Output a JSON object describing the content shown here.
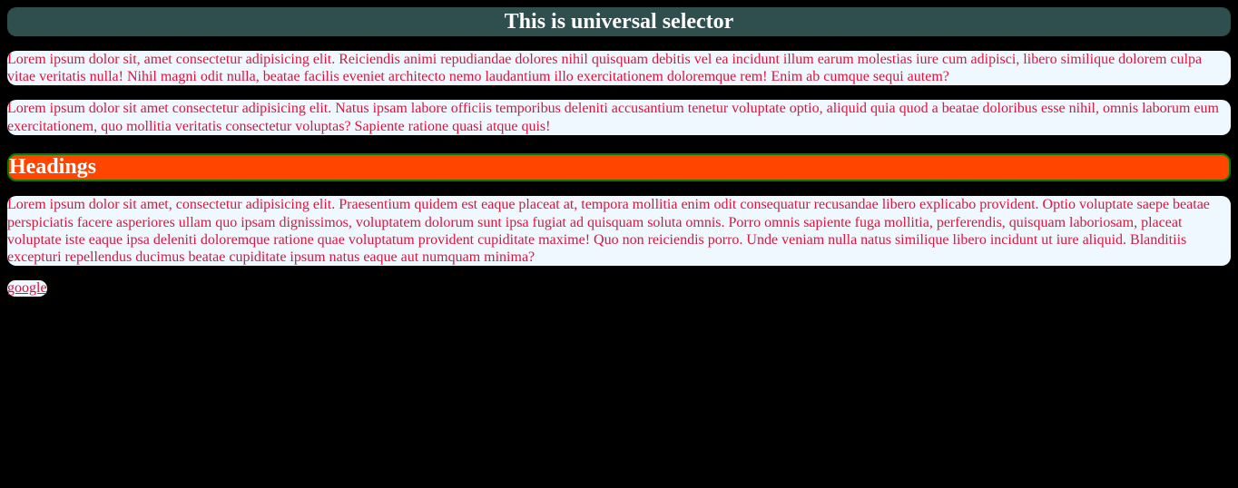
{
  "header": {
    "title": "This is universal selector"
  },
  "paragraphs": {
    "p1": "Lorem ipsum dolor sit, amet consectetur adipisicing elit. Reiciendis animi repudiandae dolores nihil quisquam debitis vel ea incidunt illum earum molestias iure cum adipisci, libero similique dolorem culpa vitae veritatis nulla! Nihil magni odit nulla, beatae facilis eveniet architecto nemo laudantium illo exercitationem doloremque rem! Enim ab cumque sequi autem?",
    "p2": "Lorem ipsum dolor sit amet consectetur adipisicing elit. Natus ipsam labore officiis temporibus deleniti accusantium tenetur voluptate optio, aliquid quia quod a beatae doloribus esse nihil, omnis laborum eum exercitationem, quo mollitia veritatis consectetur voluptas? Sapiente ratione quasi atque quis!",
    "p3": "Lorem ipsum dolor sit amet, consectetur adipisicing elit. Praesentium quidem est eaque placeat at, tempora mollitia enim odit consequatur recusandae libero explicabo provident. Optio voluptate saepe beatae perspiciatis facere asperiores ullam quo ipsam dignissimos, voluptatem dolorum sunt ipsa fugiat ad quisquam soluta omnis. Porro omnis sapiente fuga mollitia, perferendis, quisquam laboriosam, placeat voluptate iste eaque ipsa deleniti doloremque ratione quae voluptatum provident cupiditate maxime! Quo non reiciendis porro. Unde veniam nulla natus similique libero incidunt ut iure aliquid. Blanditiis excepturi repellendus ducimus beatae cupiditate ipsum natus eaque aut numquam minima?"
  },
  "subheader": {
    "title": "Headings"
  },
  "link": {
    "label": "google"
  }
}
